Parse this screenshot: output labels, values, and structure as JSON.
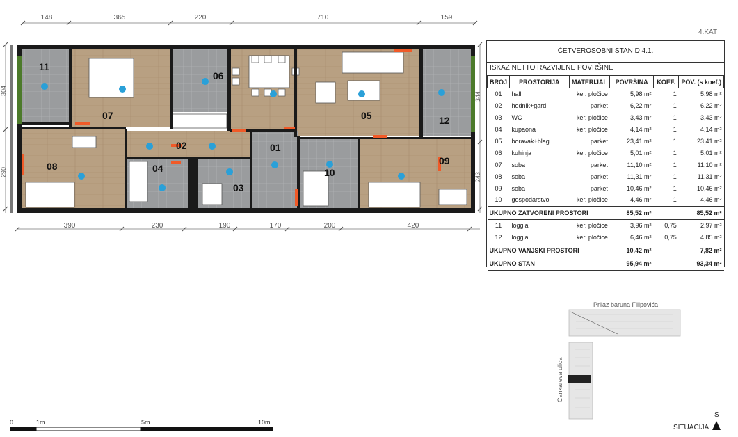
{
  "floor_label": "4.KAT",
  "dimensions": {
    "top": [
      "148",
      "365",
      "220",
      "710",
      "159"
    ],
    "bottom": [
      "390",
      "230",
      "190",
      "170",
      "200",
      "420"
    ],
    "left": [
      "304",
      "290"
    ],
    "right": [
      "344",
      "243"
    ]
  },
  "rooms": [
    {
      "num": "01"
    },
    {
      "num": "02"
    },
    {
      "num": "03"
    },
    {
      "num": "04"
    },
    {
      "num": "05"
    },
    {
      "num": "06"
    },
    {
      "num": "07"
    },
    {
      "num": "08"
    },
    {
      "num": "09"
    },
    {
      "num": "10"
    },
    {
      "num": "11"
    },
    {
      "num": "12"
    }
  ],
  "table": {
    "title": "ČETVEROSOBNI STAN D 4.1.",
    "subtitle": "ISKAZ NETTO RAZVIJENE POVRŠINE",
    "headers": [
      "BROJ",
      "PROSTORIJA",
      "MATERIJAL",
      "POVRŠINA",
      "KOEF.",
      "POV. (s koef.)"
    ],
    "rows": [
      {
        "broj": "01",
        "prostorija": "hall",
        "materijal": "ker. pločice",
        "povrsina": "5,98 m²",
        "koef": "1",
        "pov_koef": "5,98 m²"
      },
      {
        "broj": "02",
        "prostorija": "hodnik+gard.",
        "materijal": "parket",
        "povrsina": "6,22 m²",
        "koef": "1",
        "pov_koef": "6,22 m²"
      },
      {
        "broj": "03",
        "prostorija": "WC",
        "materijal": "ker. pločice",
        "povrsina": "3,43 m²",
        "koef": "1",
        "pov_koef": "3,43 m²"
      },
      {
        "broj": "04",
        "prostorija": "kupaona",
        "materijal": "ker. pločice",
        "povrsina": "4,14 m²",
        "koef": "1",
        "pov_koef": "4,14 m²"
      },
      {
        "broj": "05",
        "prostorija": "boravak+blag.",
        "materijal": "parket",
        "povrsina": "23,41 m²",
        "koef": "1",
        "pov_koef": "23,41 m²"
      },
      {
        "broj": "06",
        "prostorija": "kuhinja",
        "materijal": "ker. pločice",
        "povrsina": "5,01 m²",
        "koef": "1",
        "pov_koef": "5,01 m²"
      },
      {
        "broj": "07",
        "prostorija": "soba",
        "materijal": "parket",
        "povrsina": "11,10 m²",
        "koef": "1",
        "pov_koef": "11,10 m²"
      },
      {
        "broj": "08",
        "prostorija": "soba",
        "materijal": "parket",
        "povrsina": "11,31 m²",
        "koef": "1",
        "pov_koef": "11,31 m²"
      },
      {
        "broj": "09",
        "prostorija": "soba",
        "materijal": "parket",
        "povrsina": "10,46 m²",
        "koef": "1",
        "pov_koef": "10,46 m²"
      },
      {
        "broj": "10",
        "prostorija": "gospodarstvo",
        "materijal": "ker. pločice",
        "povrsina": "4,46 m²",
        "koef": "1",
        "pov_koef": "4,46 m²"
      }
    ],
    "sum_closed": {
      "label": "UKUPNO ZATVORENI PROSTORI",
      "povrsina": "85,52 m²",
      "pov_koef": "85,52 m²"
    },
    "rows_outside": [
      {
        "broj": "11",
        "prostorija": "loggia",
        "materijal": "ker. pločice",
        "povrsina": "3,96 m²",
        "koef": "0,75",
        "pov_koef": "2,97 m²"
      },
      {
        "broj": "12",
        "prostorija": "loggia",
        "materijal": "ker. pločice",
        "povrsina": "6,46 m²",
        "koef": "0,75",
        "pov_koef": "4,85 m²"
      }
    ],
    "sum_outside": {
      "label": "UKUPNO VANJSKI PROSTORI",
      "povrsina": "10,42 m²",
      "pov_koef": "7,82 m²"
    },
    "sum_total": {
      "label": "UKUPNO STAN",
      "povrsina": "95,94 m²",
      "pov_koef": "93,34 m²"
    }
  },
  "scale_bar": {
    "labels": [
      "0",
      "1m",
      "5m",
      "10m"
    ]
  },
  "situation": {
    "street_top": "Prilaz baruna Filipovića",
    "street_left": "Cankareva ulica",
    "north": "S",
    "label": "SITUACIJA"
  },
  "colors": {
    "wall": "#1a1a1a",
    "tile": "#9a9c9e",
    "parquet": "#b59a7a",
    "marker": "#2aa0d8",
    "accent": "#f05a28"
  }
}
